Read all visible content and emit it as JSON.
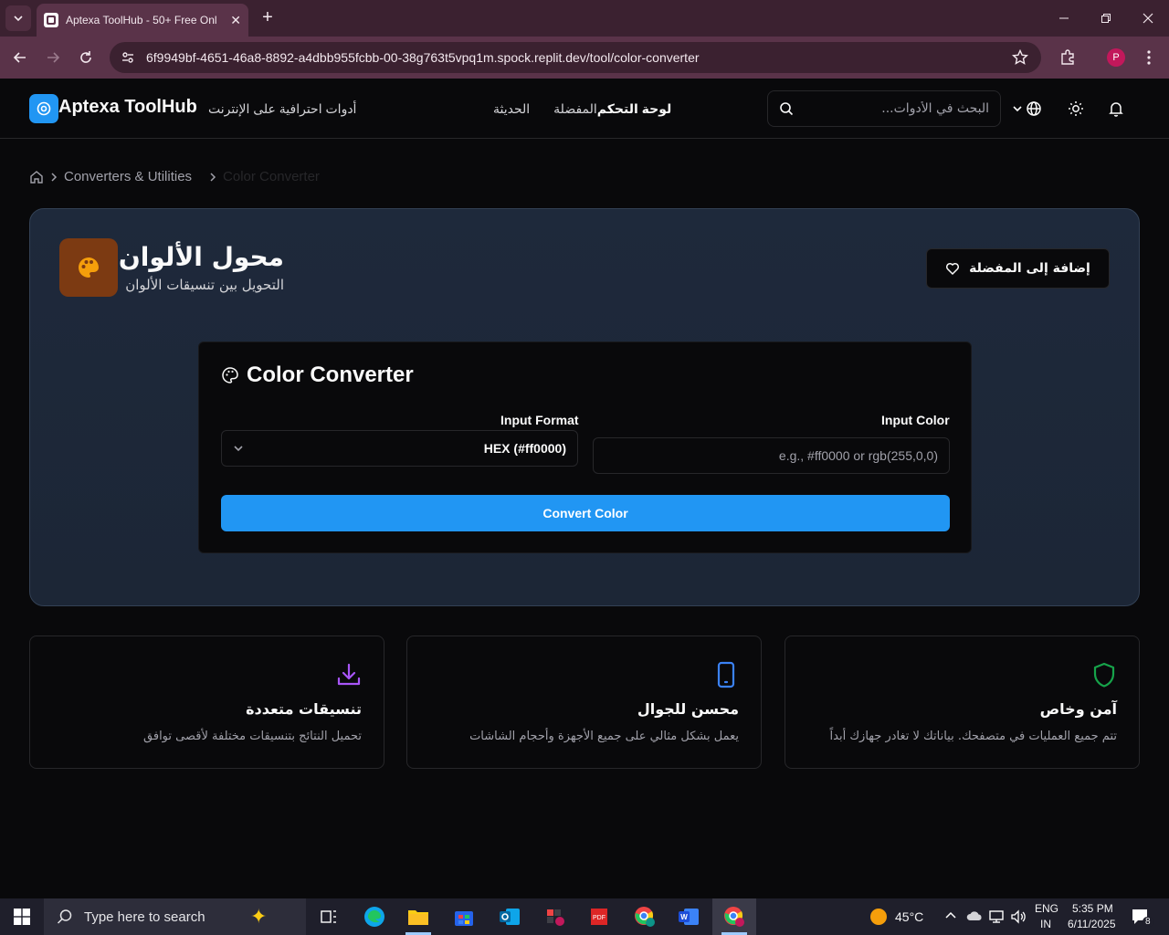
{
  "browser": {
    "tab_title": "Aptexa ToolHub - 50+ Free Onl",
    "url": "6f9949bf-4651-46a8-8892-a4dbb955fcbb-00-38g763t5vpq1m.spock.replit.dev/tool/color-converter",
    "profile_initial": "P"
  },
  "header": {
    "brand": "Aptexa ToolHub",
    "tagline": "أدوات احترافية على الإنترنت",
    "nav": {
      "recent": "الحديثة",
      "favorites": "المفضلة",
      "dashboard": "لوحة التحكم"
    },
    "search_placeholder": "البحث في الأدوات..."
  },
  "breadcrumb": {
    "category": "Converters & Utilities",
    "current": "Color Converter"
  },
  "tool": {
    "title": "محول الألوان",
    "subtitle": "التحويل بين تنسيقات الألوان",
    "favorite_button": "إضافة إلى المفضلة",
    "icon_bg": "#7c3a12",
    "icon_color": "#f59e0b"
  },
  "converter": {
    "heading": "Color Converter",
    "input_format_label": "Input Format",
    "input_format_value": "HEX (#ff0000)",
    "input_color_label": "Input Color",
    "input_color_placeholder": "e.g., #ff0000 or rgb(255,0,0)",
    "input_color_value": "",
    "convert_button": "Convert Color",
    "accent": "#2196f3"
  },
  "features": [
    {
      "title": "آمن وخاص",
      "description": "تتم جميع العمليات في متصفحك. بياناتك لا تغادر جهازك أبداً",
      "icon": "shield-icon",
      "color": "#16a34a"
    },
    {
      "title": "محسن للجوال",
      "description": "يعمل بشكل مثالي على جميع الأجهزة وأحجام الشاشات",
      "icon": "smartphone-icon",
      "color": "#3b82f6"
    },
    {
      "title": "تنسيقات متعددة",
      "description": "تحميل النتائج بتنسيقات مختلفة لأقصى توافق",
      "icon": "download-icon",
      "color": "#a855f7"
    }
  ],
  "taskbar": {
    "search_placeholder": "Type here to search",
    "weather": "45°C",
    "lang_1": "ENG",
    "lang_2": "IN",
    "time": "5:35 PM",
    "date": "6/11/2025",
    "notifications": "8"
  }
}
